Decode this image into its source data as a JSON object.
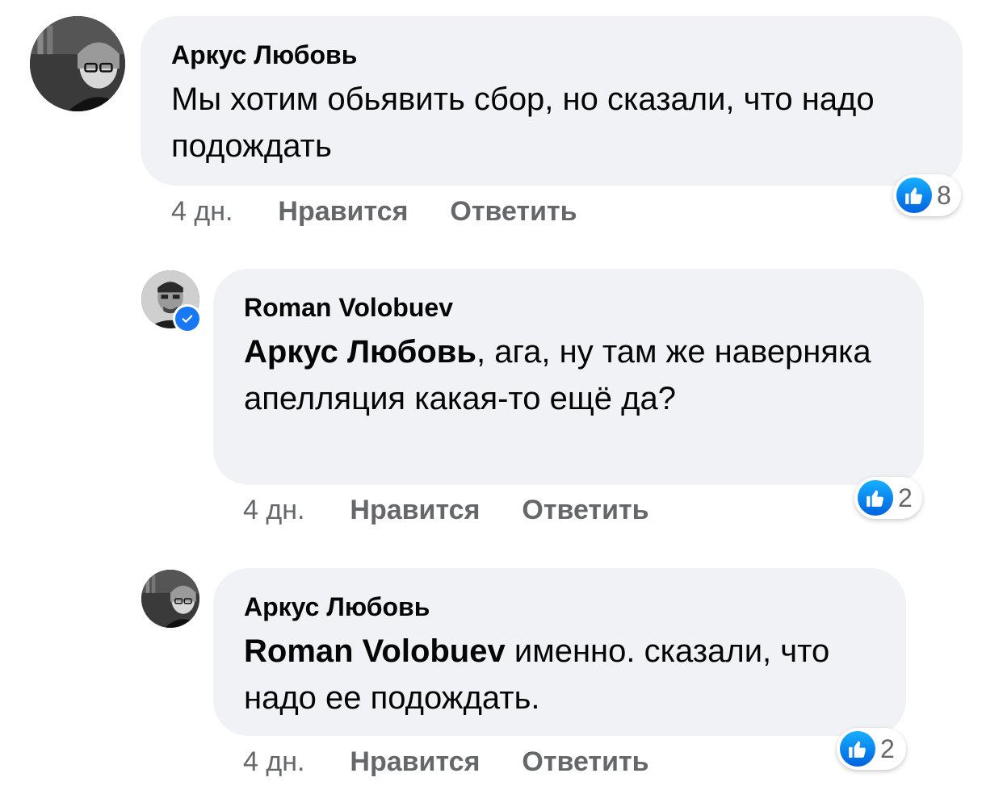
{
  "comments": [
    {
      "author": "Аркус Любовь",
      "mention": "",
      "text": "Мы хотим обьявить сбор, но сказали, что надо подождать",
      "time": "4 дн.",
      "like_label": "Нравится",
      "reply_label": "Ответить",
      "reaction_count": "8",
      "verified": false
    },
    {
      "author": "Roman Volobuev",
      "mention": "Аркус Любовь",
      "text": ", ага, ну там же наверняка апелляция какая-то ещё да?",
      "time": "4 дн.",
      "like_label": "Нравится",
      "reply_label": "Ответить",
      "reaction_count": "2",
      "verified": true
    },
    {
      "author": "Аркус Любовь",
      "mention": "Roman Volobuev",
      "text": " именно. сказали, что надо ее подождать.",
      "time": "4 дн.",
      "like_label": "Нравится",
      "reply_label": "Ответить",
      "reaction_count": "2",
      "verified": false
    }
  ],
  "icons": {
    "reaction": "like-icon",
    "verified": "verified-badge-icon"
  },
  "colors": {
    "bubble": "#f0f2f5",
    "secondary_text": "#65676b",
    "like_blue": "#1877f2"
  }
}
